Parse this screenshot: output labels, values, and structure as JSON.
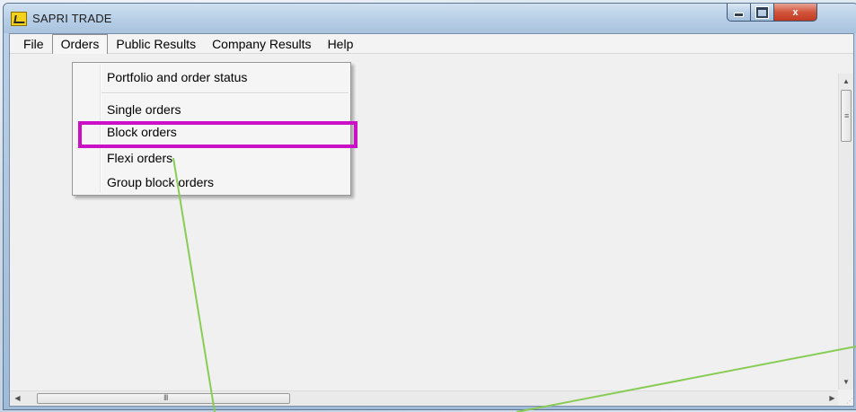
{
  "window": {
    "title": "SAPRI TRADE",
    "controls": {
      "minimize_glyph": "minimize-icon",
      "maximize_glyph": "maximize-icon",
      "close_label": "x"
    }
  },
  "menubar": {
    "items": [
      {
        "label": "File"
      },
      {
        "label": "Orders",
        "open": true
      },
      {
        "label": "Public Results"
      },
      {
        "label": "Company Results"
      },
      {
        "label": "Help"
      }
    ]
  },
  "orders_menu": {
    "items": [
      {
        "label": "Portfolio and order status"
      },
      {
        "label": "Single orders"
      },
      {
        "label": "Block orders",
        "highlighted": true
      },
      {
        "label": "Flexi orders"
      },
      {
        "label": "Group block orders"
      }
    ]
  },
  "scrollbars": {
    "vertical_grip": "≡",
    "horizontal_grip": "III"
  },
  "colors": {
    "highlight_border": "#cc10c8",
    "annotation_line": "#88cc55"
  }
}
